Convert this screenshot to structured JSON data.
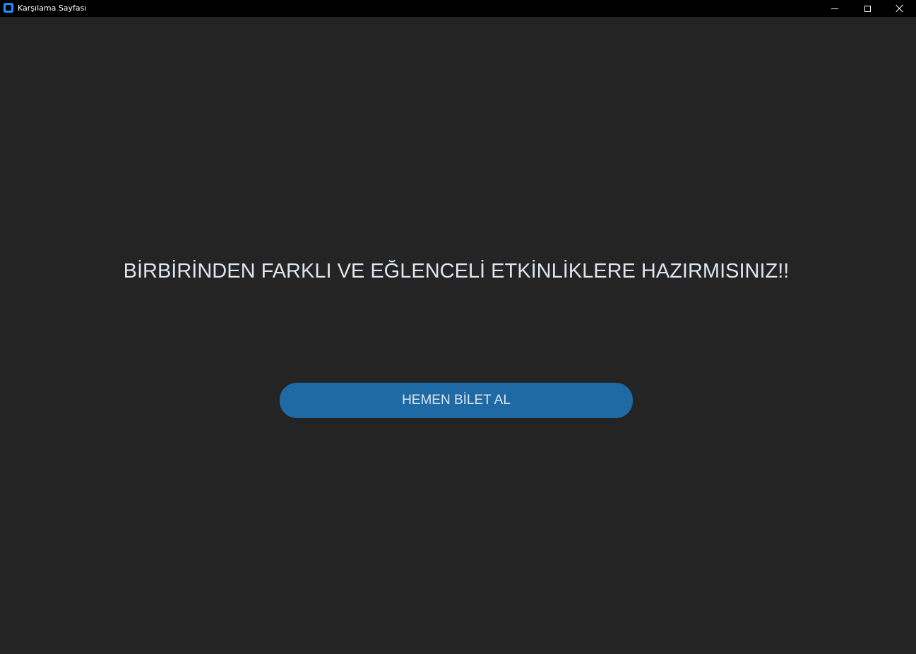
{
  "window": {
    "title": "Karşılama Sayfası",
    "icon": "app-icon"
  },
  "titlebar_controls": {
    "minimize_icon": "minimize-icon",
    "maximize_icon": "maximize-icon",
    "close_icon": "close-icon"
  },
  "main": {
    "headline": "BİRBİRİNDEN FARKLI VE EĞLENCELİ ETKİNLİKLERE HAZIRMISINIZ!!",
    "cta_label": "HEMEN BİLET AL"
  },
  "colors": {
    "background": "#242424",
    "titlebar": "#000000",
    "button": "#1f6aa5",
    "text": "#dce4ee"
  }
}
